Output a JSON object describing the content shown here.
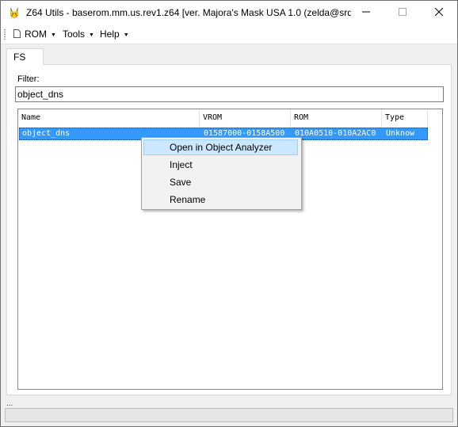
{
  "window": {
    "title": "Z64 Utils - baserom.mm.us.rev1.z64 [ver. Majora's Mask USA 1.0 (zelda@srd...",
    "app_icon": "pikachu-icon"
  },
  "menu": {
    "items": [
      {
        "label": "ROM",
        "icon": "file-icon"
      },
      {
        "label": "Tools"
      },
      {
        "label": "Help"
      }
    ]
  },
  "tabs": [
    {
      "label": "FS"
    }
  ],
  "filter": {
    "label": "Filter:",
    "value": "object_dns"
  },
  "file_list": {
    "columns": [
      "Name",
      "VROM",
      "ROM",
      "Type"
    ],
    "rows": [
      {
        "name": "object_dns",
        "vrom": "01587000-0158A500",
        "rom": "010A0510-010A2AC0",
        "type": "Unknow"
      }
    ]
  },
  "context_menu": {
    "items": [
      {
        "label": "Open in Object Analyzer",
        "highlighted": true
      },
      {
        "label": "Inject"
      },
      {
        "label": "Save"
      },
      {
        "label": "Rename"
      }
    ]
  },
  "status": {
    "text": "...",
    "progress": 0
  },
  "colors": {
    "selection": "#3399ff",
    "menu_highlight": "#cce8ff"
  }
}
